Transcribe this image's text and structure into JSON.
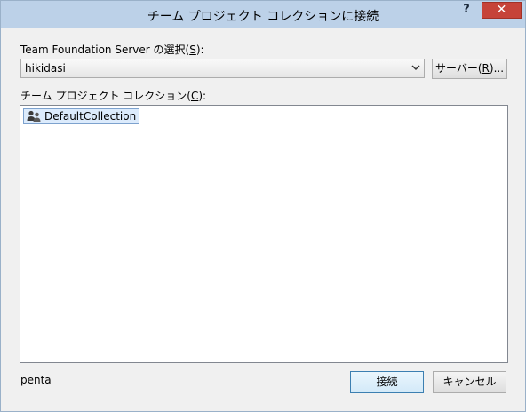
{
  "window": {
    "title": "チーム プロジェクト コレクションに接続",
    "help_label": "?",
    "close_label": "✕"
  },
  "server": {
    "label_prefix": "Team Foundation Server の選択(",
    "label_key": "S",
    "label_suffix": "):",
    "selected": "hikidasi",
    "button_prefix": "サーバー(",
    "button_key": "R",
    "button_suffix": ")..."
  },
  "collections": {
    "label_prefix": "チーム プロジェクト コレクション(",
    "label_key": "C",
    "label_suffix": "):",
    "items": [
      {
        "label": "DefaultCollection",
        "icon": "team-collection-icon"
      }
    ]
  },
  "footer": {
    "user": "penta",
    "connect_label": "接続",
    "cancel_label": "キャンセル"
  }
}
